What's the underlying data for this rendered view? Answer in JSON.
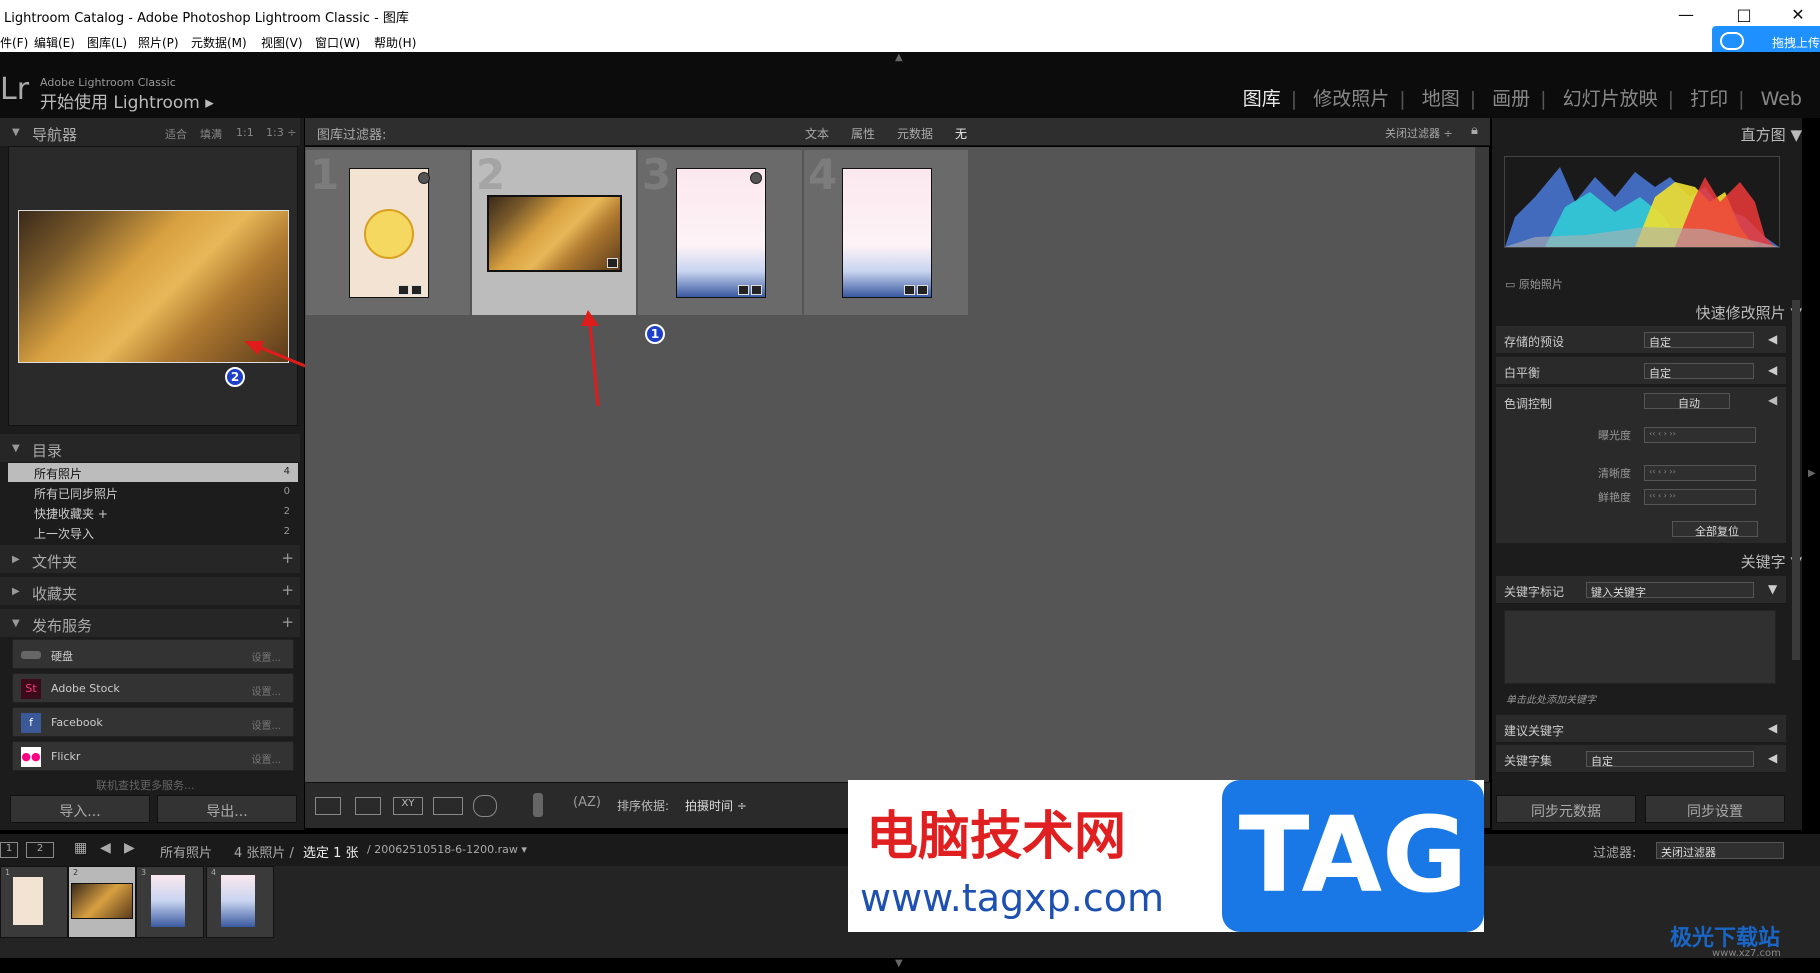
{
  "window": {
    "title": "Lightroom Catalog - Adobe Photoshop Lightroom Classic - 图库",
    "min": "—",
    "max": "□",
    "close": "✕"
  },
  "menu": [
    "件(F)",
    "编辑(E)",
    "图库(L)",
    "照片(P)",
    "元数据(M)",
    "视图(V)",
    "窗口(W)",
    "帮助(H)"
  ],
  "baidu": {
    "label": "拖拽上传"
  },
  "header": {
    "logo": "Lr",
    "brand_top": "Adobe Lightroom Classic",
    "brand_main": "开始使用 Lightroom ▸",
    "modules": [
      "图库",
      "修改照片",
      "地图",
      "画册",
      "幻灯片放映",
      "打印",
      "Web"
    ]
  },
  "navigator": {
    "title": "导航器",
    "zoom": [
      "适合",
      "填满",
      "1:1",
      "1:3 ÷"
    ]
  },
  "catalog": {
    "title": "目录",
    "items": [
      {
        "label": "所有照片",
        "count": "4"
      },
      {
        "label": "所有已同步照片",
        "count": "0"
      },
      {
        "label": "快捷收藏夹 +",
        "count": "2"
      },
      {
        "label": "上一次导入",
        "count": "2"
      }
    ]
  },
  "folders": {
    "title": "文件夹"
  },
  "collections": {
    "title": "收藏夹"
  },
  "publish": {
    "title": "发布服务",
    "items": [
      {
        "label": "硬盘",
        "setting": "设置..."
      },
      {
        "label": "Adobe Stock",
        "setting": "设置..."
      },
      {
        "label": "Facebook",
        "setting": "设置..."
      },
      {
        "label": "Flickr",
        "setting": "设置..."
      }
    ],
    "more": "联机查找更多服务..."
  },
  "actions": {
    "import": "导入...",
    "export": "导出..."
  },
  "filter": {
    "title": "图库过滤器:",
    "tabs": [
      "文本",
      "属性",
      "元数据",
      "无"
    ],
    "close": "关闭过滤器 ÷"
  },
  "grid": {
    "cells": [
      "1",
      "2",
      "3",
      "4"
    ],
    "selected": 2
  },
  "toolbar": {
    "sort_label": "排序依据:",
    "sort_value": "拍摄时间 ÷"
  },
  "histogram": {
    "title": "直方图",
    "original": "原始照片"
  },
  "quick": {
    "title": "快速修改照片",
    "preset_label": "存储的预设",
    "preset_value": "自定",
    "wb_label": "白平衡",
    "wb_value": "自定",
    "tone_label": "色调控制",
    "auto": "自动",
    "exposure": "曝光度",
    "clarity": "清晰度",
    "vibrance": "鲜艳度",
    "reset": "全部复位"
  },
  "keywords": {
    "title": "关键字",
    "tag_label": "关键字标记",
    "tag_value": "键入关键字",
    "hint": "单击此处添加关键字",
    "suggest": "建议关键字",
    "set_label": "关键字集",
    "set_value": "自定"
  },
  "sync": {
    "meta": "同步元数据",
    "settings": "同步设置"
  },
  "strip": {
    "source": "所有照片",
    "count": "4 张照片 /",
    "selected": "选定 1 张",
    "file": "/ 20062510518-6-1200.raw ▾",
    "filter_label": "过滤器:",
    "filter_value": "关闭过滤器"
  },
  "annotations": [
    "1",
    "2"
  ],
  "watermark": {
    "cn": "电脑技术网",
    "url": "www.tagxp.com",
    "tag": "TAG",
    "site": "极光下载站",
    "site_url": "www.xz7.com"
  }
}
